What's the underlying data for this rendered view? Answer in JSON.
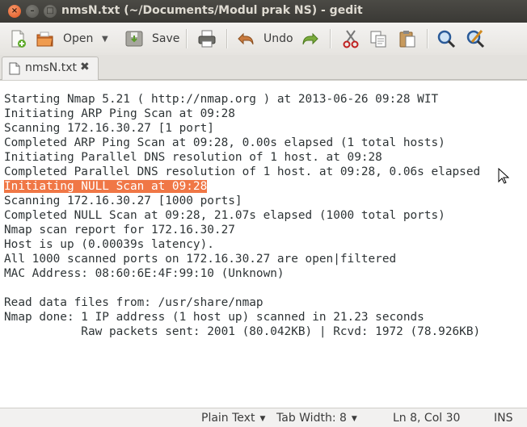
{
  "window": {
    "title": "nmsN.txt (~/Documents/Modul prak NS) - gedit",
    "controls": {
      "close": "×",
      "minimize": "–",
      "maximize": "□"
    }
  },
  "toolbar": {
    "open_label": "Open",
    "save_label": "Save",
    "undo_label": "Undo",
    "icons": [
      "new-document-icon",
      "open-folder-icon",
      "save-icon",
      "print-icon",
      "undo-icon",
      "redo-icon",
      "cut-icon",
      "copy-icon",
      "paste-icon",
      "find-icon",
      "find-replace-icon"
    ]
  },
  "tabs": [
    {
      "label": "nmsN.txt",
      "close": "✖"
    }
  ],
  "document": {
    "highlight_color": "#f07746",
    "lines": [
      "Starting Nmap 5.21 ( http://nmap.org ) at 2013-06-26 09:28 WIT",
      "Initiating ARP Ping Scan at 09:28",
      "Scanning 172.16.30.27 [1 port]",
      "Completed ARP Ping Scan at 09:28, 0.00s elapsed (1 total hosts)",
      "Initiating Parallel DNS resolution of 1 host. at 09:28",
      "Completed Parallel DNS resolution of 1 host. at 09:28, 0.06s elapsed",
      "Initiating NULL Scan at 09:28",
      "Scanning 172.16.30.27 [1000 ports]",
      "Completed NULL Scan at 09:28, 21.07s elapsed (1000 total ports)",
      "Nmap scan report for 172.16.30.27",
      "Host is up (0.00039s latency).",
      "All 1000 scanned ports on 172.16.30.27 are open|filtered",
      "MAC Address: 08:60:6E:4F:99:10 (Unknown)",
      "",
      "Read data files from: /usr/share/nmap",
      "Nmap done: 1 IP address (1 host up) scanned in 21.23 seconds",
      "           Raw packets sent: 2001 (80.042KB) | Rcvd: 1972 (78.926KB)"
    ]
  },
  "statusbar": {
    "language": "Plain Text",
    "tab_width": "Tab Width:  8",
    "position": "Ln 8, Col 30",
    "mode": "INS"
  }
}
